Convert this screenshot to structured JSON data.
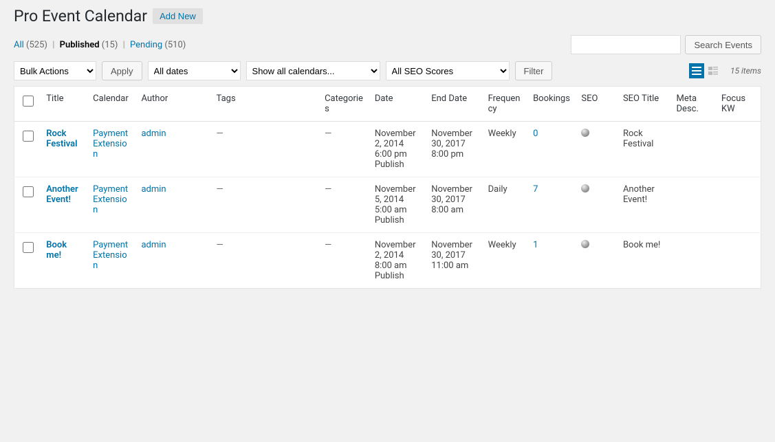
{
  "header": {
    "title": "Pro Event Calendar",
    "add_new": "Add New"
  },
  "status_links": {
    "all_label": "All",
    "all_count": "(525)",
    "published_label": "Published",
    "published_count": "(15)",
    "pending_label": "Pending",
    "pending_count": "(510)"
  },
  "search": {
    "button": "Search Events"
  },
  "filters": {
    "bulk_actions": "Bulk Actions",
    "apply": "Apply",
    "all_dates": "All dates",
    "show_all_calendars": "Show all calendars...",
    "all_seo_scores": "All SEO Scores",
    "filter": "Filter",
    "items_count": "15 items"
  },
  "columns": {
    "title": "Title",
    "calendar": "Calendar",
    "author": "Author",
    "tags": "Tags",
    "categories": "Categories",
    "date": "Date",
    "end_date": "End Date",
    "frequency": "Frequency",
    "bookings": "Bookings",
    "seo": "SEO",
    "seo_title": "SEO Title",
    "meta_desc": "Meta Desc.",
    "focus_kw": "Focus KW"
  },
  "rows": [
    {
      "title": "Rock Festival",
      "calendar": "Payment Extension",
      "author": "admin",
      "tags": "—",
      "categories": "—",
      "date_l1": "November 2, 2014",
      "date_l2": "6:00 pm",
      "date_l3": "Publish",
      "end_l1": "November 30, 2017",
      "end_l2": "8:00 pm",
      "frequency": "Weekly",
      "bookings": "0",
      "seo_title": "Rock Festival",
      "meta_desc": "",
      "focus_kw": ""
    },
    {
      "title": "Another Event!",
      "calendar": "Payment Extension",
      "author": "admin",
      "tags": "—",
      "categories": "—",
      "date_l1": "November 5, 2014",
      "date_l2": "5:00 am",
      "date_l3": "Publish",
      "end_l1": "November 30, 2017",
      "end_l2": "8:00 am",
      "frequency": "Daily",
      "bookings": "7",
      "seo_title": "Another Event!",
      "meta_desc": "",
      "focus_kw": ""
    },
    {
      "title": "Book me!",
      "calendar": "Payment Extension",
      "author": "admin",
      "tags": "—",
      "categories": "—",
      "date_l1": "November 2, 2014",
      "date_l2": "8:00 am",
      "date_l3": "Publish",
      "end_l1": "November 30, 2017",
      "end_l2": "11:00 am",
      "frequency": "Weekly",
      "bookings": "1",
      "seo_title": "Book me!",
      "meta_desc": "",
      "focus_kw": ""
    }
  ]
}
